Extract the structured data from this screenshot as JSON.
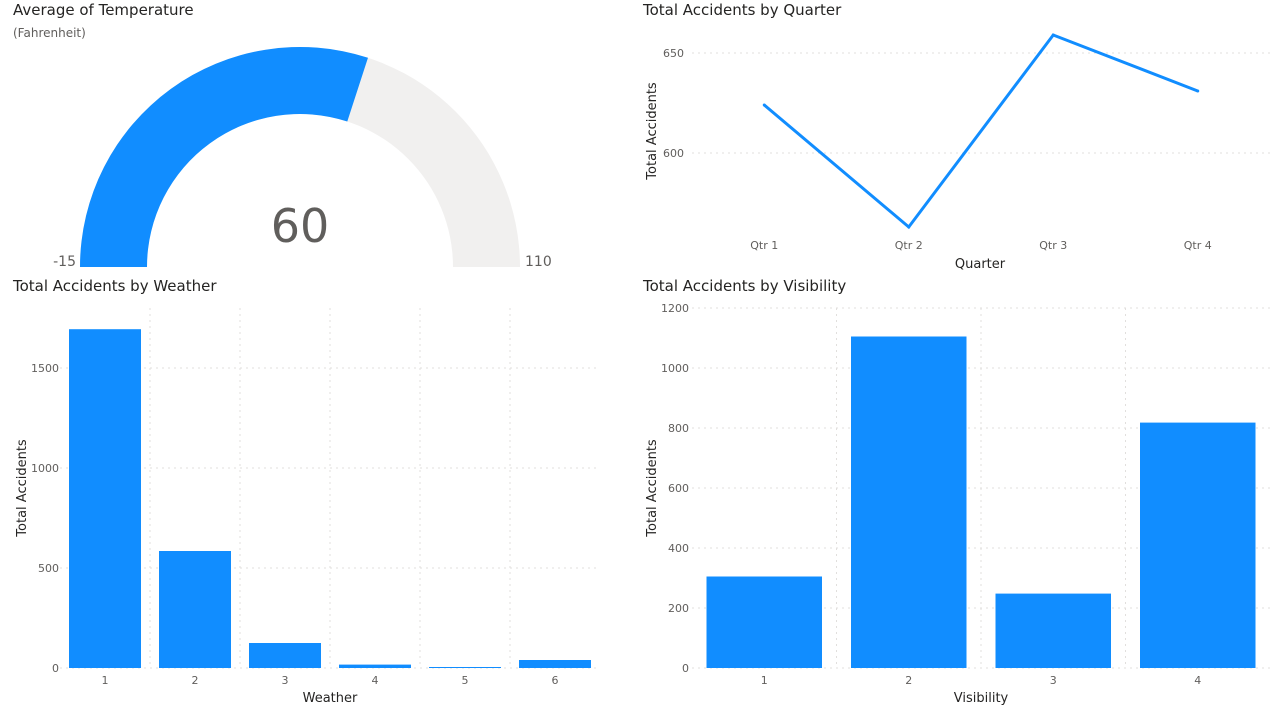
{
  "accent": "#118dff",
  "track": "#f1f0ef",
  "chart_data": [
    {
      "type": "gauge",
      "title": "Average of Temperature",
      "subtitle": "(Fahrenheit)",
      "value": 60,
      "value_label": "60",
      "min": -15,
      "max": 110,
      "min_label": "-15",
      "max_label": "110"
    },
    {
      "type": "line",
      "title": "Total Accidents by Quarter",
      "xlabel": "Quarter",
      "ylabel": "Total Accidents",
      "categories": [
        "Qtr 1",
        "Qtr 2",
        "Qtr 3",
        "Qtr 4"
      ],
      "values": [
        624,
        563,
        659,
        631
      ],
      "ylim": [
        563,
        659
      ],
      "yticks": [
        600,
        650
      ],
      "grid": true
    },
    {
      "type": "bar",
      "title": "Total Accidents by Weather",
      "xlabel": "Weather",
      "ylabel": "Total Accidents",
      "categories": [
        "1",
        "2",
        "3",
        "4",
        "5",
        "6"
      ],
      "values": [
        1694,
        585,
        125,
        17,
        5,
        40
      ],
      "ylim": [
        0,
        1800
      ],
      "yticks": [
        0,
        500,
        1000,
        1500
      ],
      "grid": true
    },
    {
      "type": "bar",
      "title": "Total Accidents by Visibility",
      "xlabel": "Visibility",
      "ylabel": "Total Accidents",
      "categories": [
        "1",
        "2",
        "3",
        "4"
      ],
      "values": [
        305,
        1105,
        248,
        818
      ],
      "ylim": [
        0,
        1200
      ],
      "yticks": [
        0,
        200,
        400,
        600,
        800,
        1000,
        1200
      ],
      "grid": true
    }
  ]
}
